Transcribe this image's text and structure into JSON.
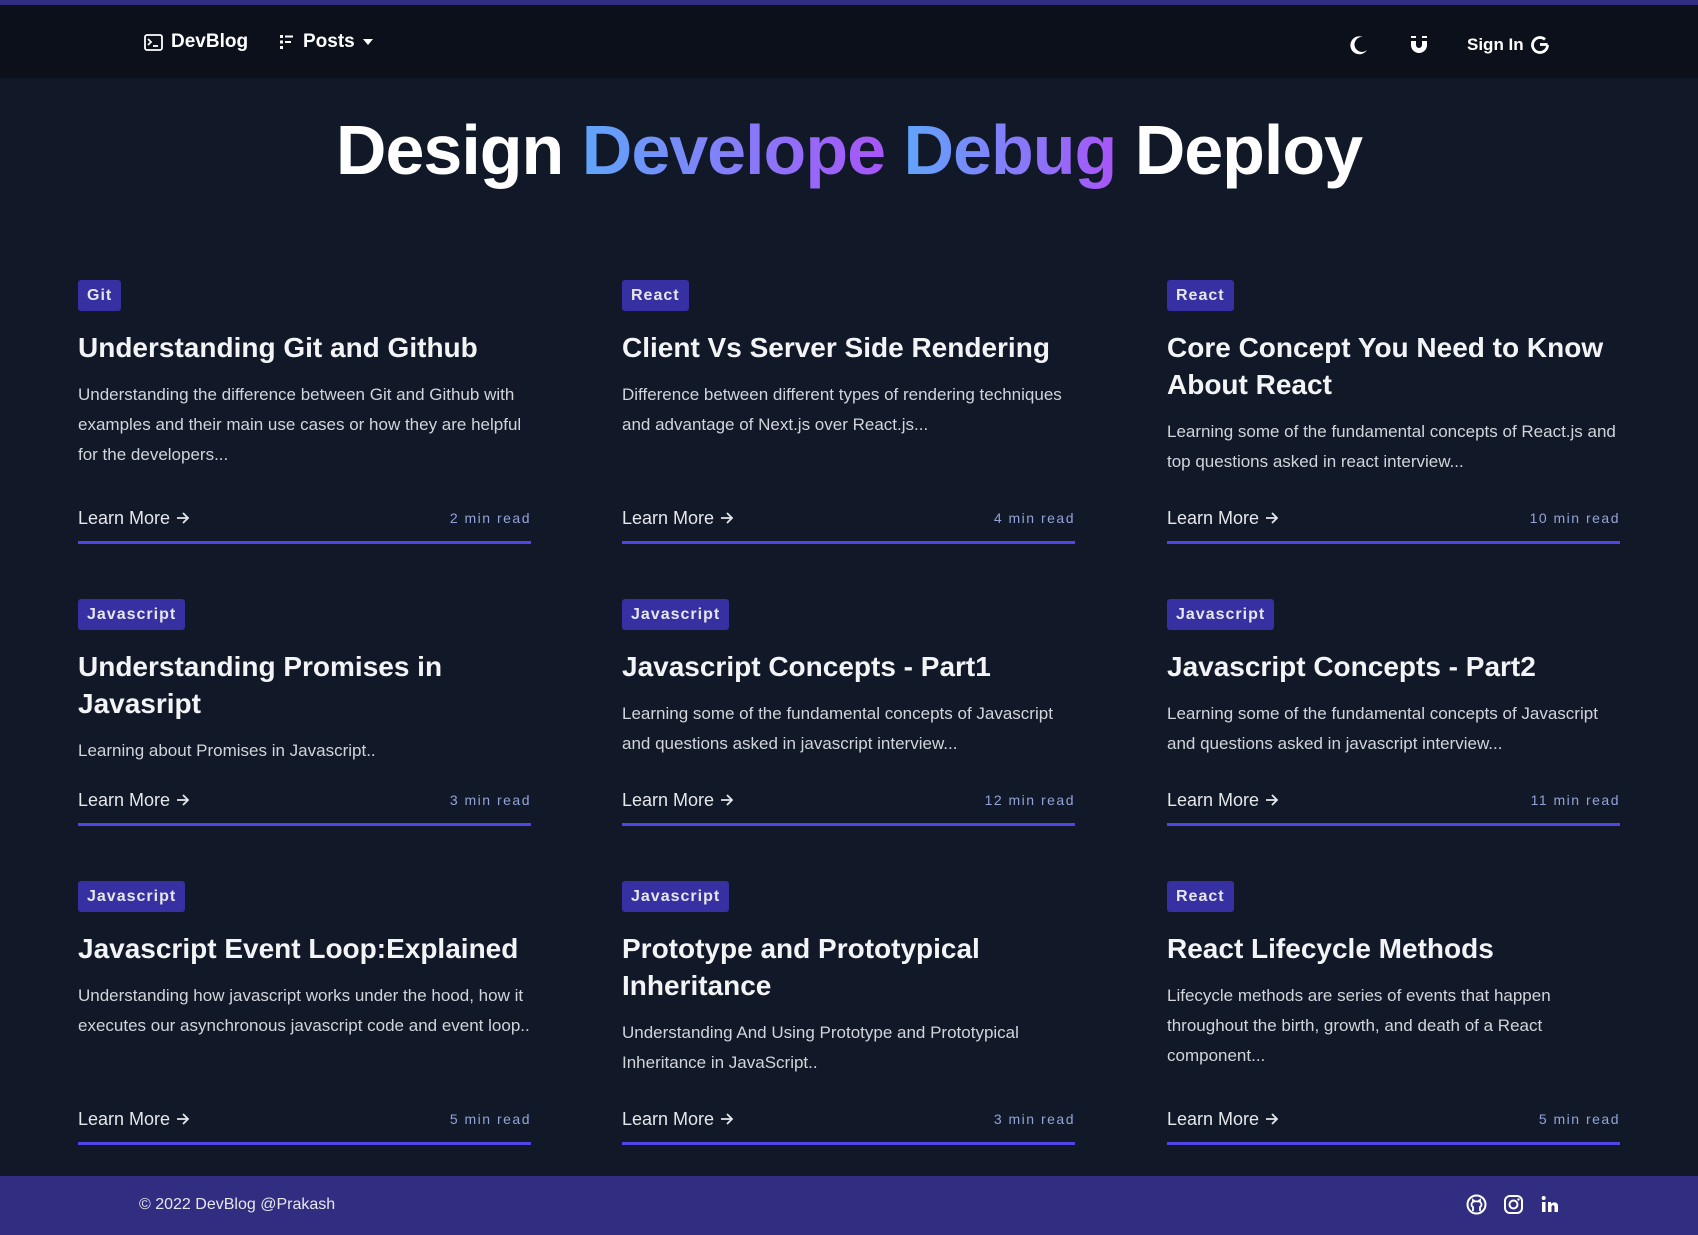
{
  "nav": {
    "brand": "DevBlog",
    "posts_label": "Posts",
    "sign_in": "Sign In"
  },
  "hero": {
    "word1": "Design",
    "word2": "Develope",
    "word3": "Debug",
    "word4": "Deploy"
  },
  "cards": [
    {
      "tag": "Git",
      "title": "Understanding Git and Github",
      "desc": "Understanding the difference between Git and Github with examples and their main use cases or how they are helpful for the developers...",
      "cta": "Learn More",
      "read": "2 min read"
    },
    {
      "tag": "React",
      "title": "Client Vs Server Side Rendering",
      "desc": "Difference between different types of rendering techniques and advantage of Next.js over React.js...",
      "cta": "Learn More",
      "read": "4 min read"
    },
    {
      "tag": "React",
      "title": "Core Concept You Need to Know About React",
      "desc": "Learning some of the fundamental concepts of React.js and top questions asked in react interview...",
      "cta": "Learn More",
      "read": "10 min read"
    },
    {
      "tag": "Javascript",
      "title": "Understanding Promises in Javasript",
      "desc": "Learning about Promises in Javascript..",
      "cta": "Learn More",
      "read": "3 min read"
    },
    {
      "tag": "Javascript",
      "title": "Javascript Concepts - Part1",
      "desc": "Learning some of the fundamental concepts of Javascript and questions asked in javascript interview...",
      "cta": "Learn More",
      "read": "12 min read"
    },
    {
      "tag": "Javascript",
      "title": "Javascript Concepts - Part2",
      "desc": "Learning some of the fundamental concepts of Javascript and questions asked in javascript interview...",
      "cta": "Learn More",
      "read": "11 min read"
    },
    {
      "tag": "Javascript",
      "title": "Javascript Event Loop:Explained",
      "desc": "Understanding how javascript works under the hood, how it executes our asynchronous javascript code and event loop..",
      "cta": "Learn More",
      "read": "5 min read"
    },
    {
      "tag": "Javascript",
      "title": "Prototype and Prototypical Inheritance",
      "desc": "Understanding And Using Prototype and Prototypical Inheritance in JavaScript..",
      "cta": "Learn More",
      "read": "3 min read"
    },
    {
      "tag": "React",
      "title": "React Lifecycle Methods",
      "desc": "Lifecycle methods are series of events that happen throughout the birth, growth, and death of a React component...",
      "cta": "Learn More",
      "read": "5 min read"
    }
  ],
  "footer": {
    "copyright": "© 2022 DevBlog @Prakash"
  },
  "icons": {
    "brand": "terminal-icon",
    "posts": "list-icon",
    "dropdown": "caret-down-icon",
    "theme": "moon-icon",
    "logo": "magnet-icon",
    "signin": "google-icon",
    "arrow": "arrow-right-icon",
    "github": "github-icon",
    "instagram": "instagram-icon",
    "linkedin": "linkedin-icon"
  },
  "colors": {
    "background": "#111827",
    "navbar": "#0b101b",
    "footer": "#312e81",
    "tag": "#3730a3",
    "underline": "#4f46e5",
    "gradient_start": "#60a5fa",
    "gradient_end": "#a855f7"
  }
}
